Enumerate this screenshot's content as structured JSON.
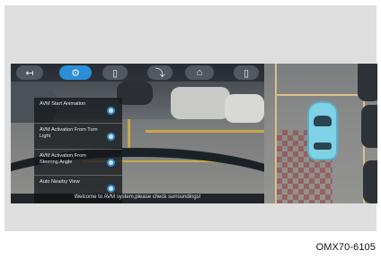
{
  "topbar": {
    "buttons": [
      {
        "name": "back-button",
        "glyph": "↤"
      },
      {
        "name": "settings-button",
        "glyph": "⚙"
      },
      {
        "name": "car-view-button",
        "glyph": "▯"
      },
      {
        "name": "camera-view-button",
        "glyph": "⤵"
      },
      {
        "name": "front-view-button",
        "glyph": "⌂"
      },
      {
        "name": "rear-view-button",
        "glyph": "▯"
      }
    ]
  },
  "menu": {
    "items": [
      {
        "label": "AVM Start Animation",
        "enabled": true
      },
      {
        "label": "AVM Activation From Turn Light",
        "enabled": true
      },
      {
        "label": "AVM Activation From Steering Angle",
        "enabled": true
      },
      {
        "label": "Auto Nearby View",
        "enabled": true
      }
    ]
  },
  "status": {
    "message": "Welcome to AVM system,please check surroundings!"
  },
  "caption": "OMX70-6105",
  "colors": {
    "accent": "#2a8fd8",
    "ego_car": "#7fd1e6"
  }
}
